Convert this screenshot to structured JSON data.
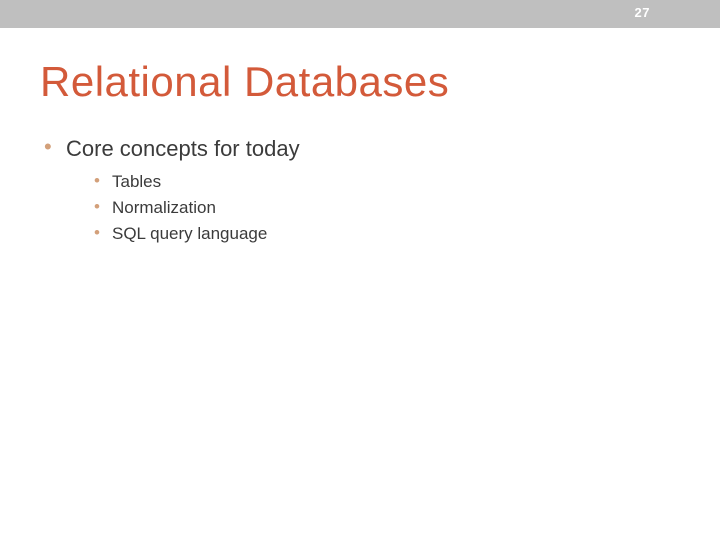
{
  "slide": {
    "page_number": "27",
    "title": "Relational Databases",
    "bullets": {
      "main": "Core concepts for today",
      "sub": [
        "Tables",
        "Normalization",
        "SQL query language"
      ]
    }
  }
}
